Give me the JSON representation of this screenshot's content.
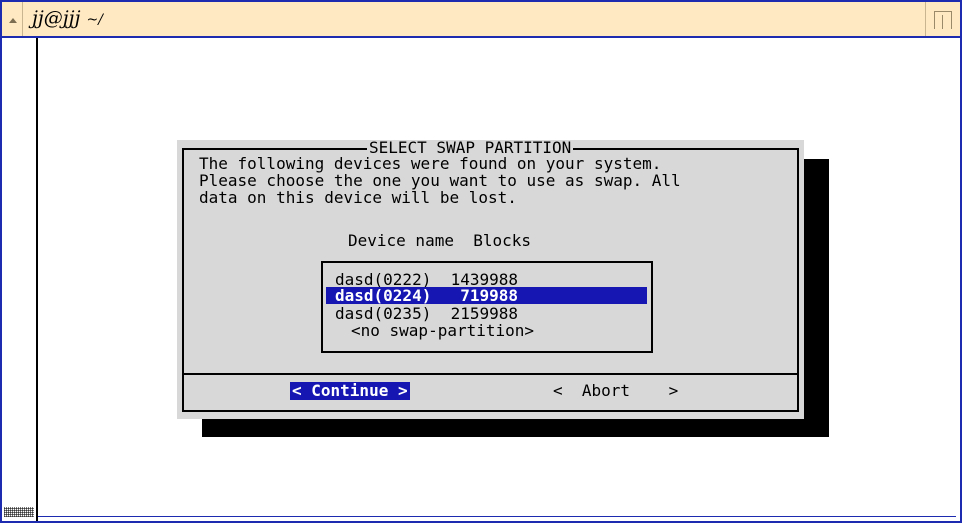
{
  "window": {
    "title": "jj@jjj",
    "title_path": "~/"
  },
  "dialog": {
    "title": "SELECT SWAP PARTITION",
    "message": "The following devices were found on your system.\nPlease choose the one you want to use as swap. All\ndata on this device will be lost.",
    "column_headers": "Device name  Blocks",
    "devices": [
      {
        "text": "dasd(0222)  1439988",
        "selected": false
      },
      {
        "text": "dasd(0224)   719988",
        "selected": true
      },
      {
        "text": "dasd(0235)  2159988",
        "selected": false
      },
      {
        "text": "<no swap-partition>",
        "selected": false
      }
    ],
    "continue_label": "< Continue >",
    "abort_label": "<  Abort    >"
  },
  "colors": {
    "border": "#1c2bb0",
    "titlebar": "#ffe9c2",
    "dialog_bg": "#d8d8d8",
    "highlight": "#1617b3"
  }
}
